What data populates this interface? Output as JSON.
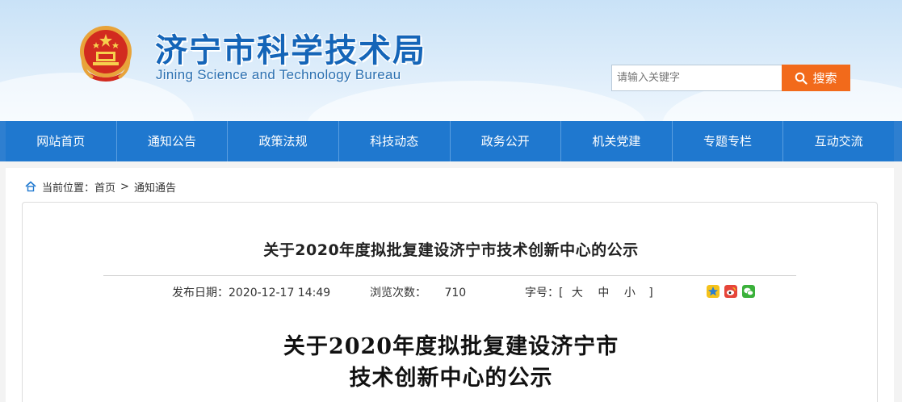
{
  "header": {
    "title": "济宁市科学技术局",
    "subtitle": "Jining Science and Technology Bureau",
    "emblem_icon": "national-emblem-icon"
  },
  "search": {
    "placeholder": "请输入关键字",
    "button_label": "搜索",
    "accent_color": "#f26a1b"
  },
  "nav": {
    "items": [
      "网站首页",
      "通知公告",
      "政策法规",
      "科技动态",
      "政务公开",
      "机关党建",
      "专题专栏",
      "互动交流"
    ],
    "color": "#1f78cf"
  },
  "breadcrumb": {
    "prefix": "当前位置：",
    "home": "首页",
    "separator": ">",
    "current": "通知通告"
  },
  "article": {
    "title": "关于2020年度拟批复建设济宁市技术创新中心的公示",
    "publish_label": "发布日期：",
    "publish_date": "2020-12-17 14:49",
    "views_label": "浏览次数：",
    "views": "710",
    "font_label": "字号：[",
    "font_large": "大",
    "font_medium": "中",
    "font_small": "小",
    "font_close": "]",
    "share_icons": [
      "qzone-icon",
      "weibo-icon",
      "wechat-icon"
    ],
    "doc_title_line1": "关于2020年度拟批复建设济宁市",
    "doc_title_line2": "技术创新中心的公示"
  }
}
